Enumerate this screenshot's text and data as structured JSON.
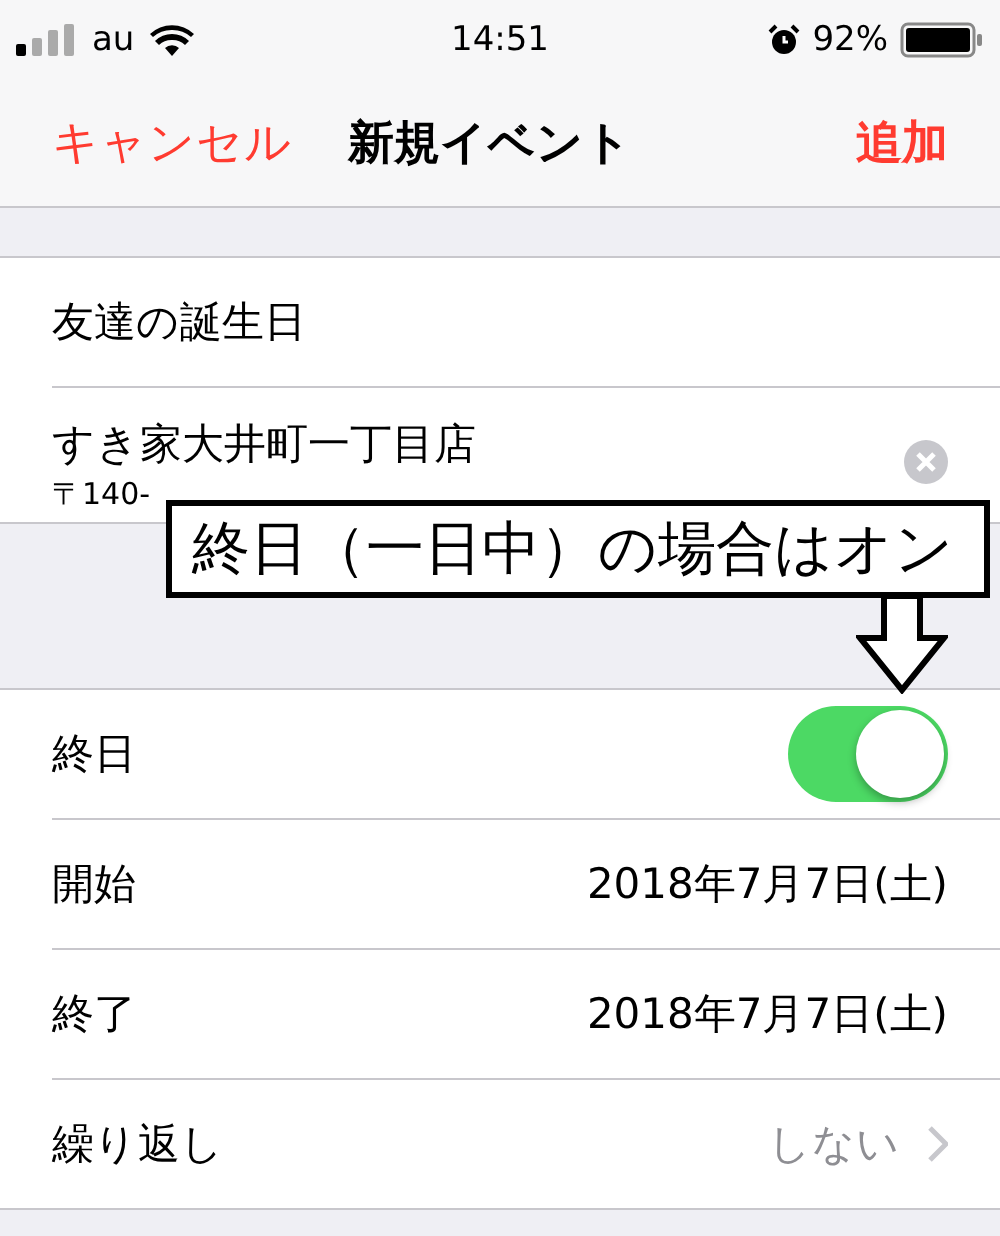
{
  "status_bar": {
    "carrier": "au",
    "time": "14:51",
    "battery": "92%"
  },
  "nav": {
    "cancel": "キャンセル",
    "title": "新規イベント",
    "add": "追加"
  },
  "title_field": {
    "value": "友達の誕生日"
  },
  "location_field": {
    "value": "すき家大井町一丁目店",
    "address": "〒140-"
  },
  "rows": [
    {
      "kind": "toggle",
      "label": "終日",
      "on": true
    },
    {
      "kind": "value",
      "label": "開始",
      "value": "2018年7月7日(土)"
    },
    {
      "kind": "value",
      "label": "終了",
      "value": "2018年7月7日(土)"
    },
    {
      "kind": "link",
      "label": "繰り返し",
      "value": "しない"
    }
  ],
  "callout": {
    "text": "終日（一日中）の場合はオン"
  }
}
